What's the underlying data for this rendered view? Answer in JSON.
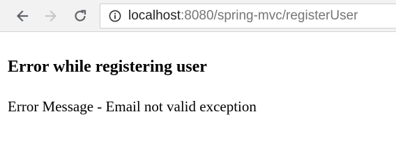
{
  "browser": {
    "back_icon": "arrow-left-icon",
    "forward_icon": "arrow-right-icon",
    "reload_icon": "reload-icon",
    "info_icon": "info-circle-icon",
    "url_host": "localhost",
    "url_rest": ":8080/spring-mvc/registerUser",
    "forward_disabled": true
  },
  "page": {
    "heading": "Error while registering user",
    "error_message": "Error Message - Email not valid exception"
  },
  "colors": {
    "toolbar_bg": "#f2f2f2",
    "url_host": "#222222",
    "url_path": "#757575",
    "icon_active": "#5f6368",
    "icon_disabled": "#c8c8c8"
  }
}
